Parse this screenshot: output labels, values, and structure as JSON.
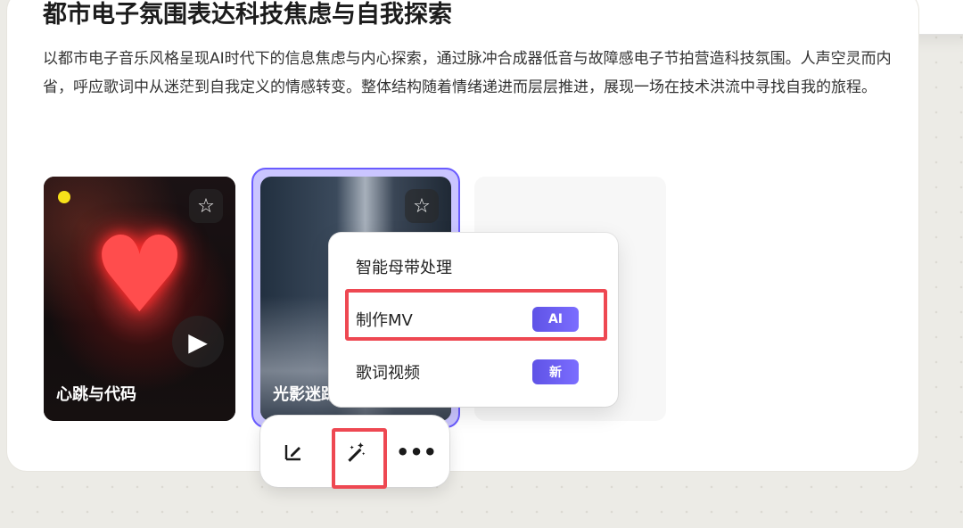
{
  "song": {
    "title": "都市电子氛围表达科技焦虑与自我探索",
    "description": "以都市电子音乐风格呈现AI时代下的信息焦虑与内心探索，通过脉冲合成器低音与故障感电子节拍营造科技氛围。人声空灵而内省，呼应歌词中从迷茫到自我定义的情感转变。整体结构随着情绪递进而层层推进，展现一场在技术洪流中寻找自我的旅程。"
  },
  "cards": [
    {
      "title": "心跳与代码",
      "status_color": "#f7e11a"
    },
    {
      "title": "光影迷踪"
    }
  ],
  "menu": {
    "items": [
      {
        "label": "智能母带处理",
        "badge": ""
      },
      {
        "label": "制作MV",
        "badge": "AI"
      },
      {
        "label": "歌词视频",
        "badge": "新"
      }
    ]
  },
  "toolbar": {
    "edit_icon": "edit-icon",
    "magic_icon": "magic-wand-icon",
    "more_icon": "more-icon"
  },
  "colors": {
    "accent": "#6a5cff",
    "highlight": "#ee4852"
  }
}
